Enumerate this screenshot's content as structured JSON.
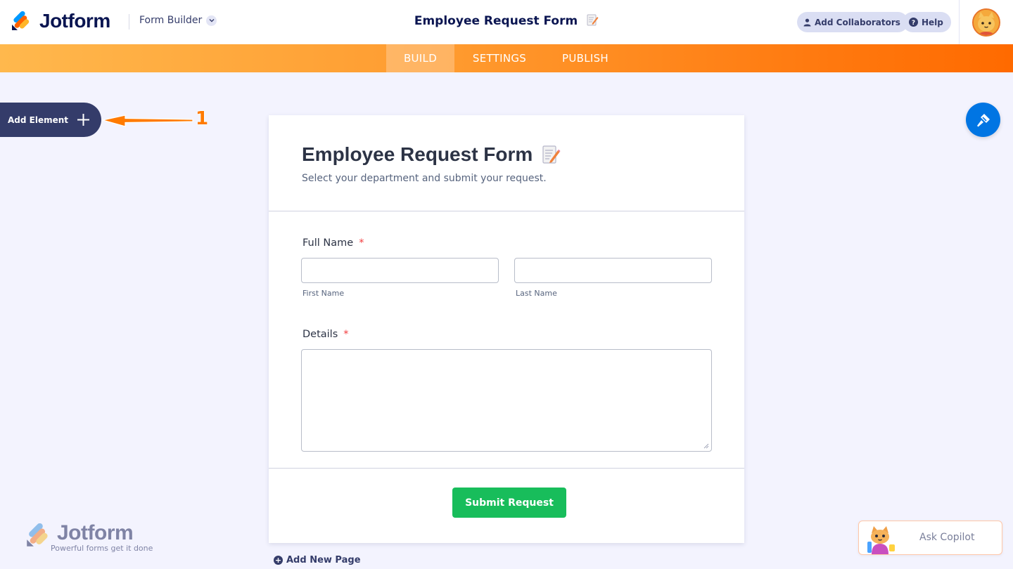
{
  "app": {
    "brand": "Jotform",
    "builder_switch": "Form Builder",
    "form_title": "Employee Request Form",
    "add_collaborators": "Add Collaborators",
    "help": "Help"
  },
  "nav": {
    "tabs": [
      {
        "label": "BUILD",
        "active": true
      },
      {
        "label": "SETTINGS",
        "active": false
      },
      {
        "label": "PUBLISH",
        "active": false
      }
    ]
  },
  "sidebar": {
    "add_element": "Add Element"
  },
  "annotation": {
    "number": "1"
  },
  "form": {
    "title": "Employee Request Form",
    "subtitle": "Select your department and submit your request.",
    "full_name": {
      "label": "Full Name",
      "required_mark": "*",
      "first_value": "",
      "last_value": "",
      "first_sublabel": "First Name",
      "last_sublabel": "Last Name"
    },
    "details": {
      "label": "Details",
      "required_mark": "*",
      "value": ""
    },
    "submit_label": "Submit Request"
  },
  "add_new_page": "Add New Page",
  "watermark": {
    "brand": "Jotform",
    "tagline": "Powerful forms get it done"
  },
  "copilot": {
    "label": "Ask Copilot"
  },
  "colors": {
    "navy": "#0a1551",
    "orange": "#ff7a00",
    "green": "#18bd5b",
    "blue": "#0075e3",
    "required": "#f23a3c"
  }
}
